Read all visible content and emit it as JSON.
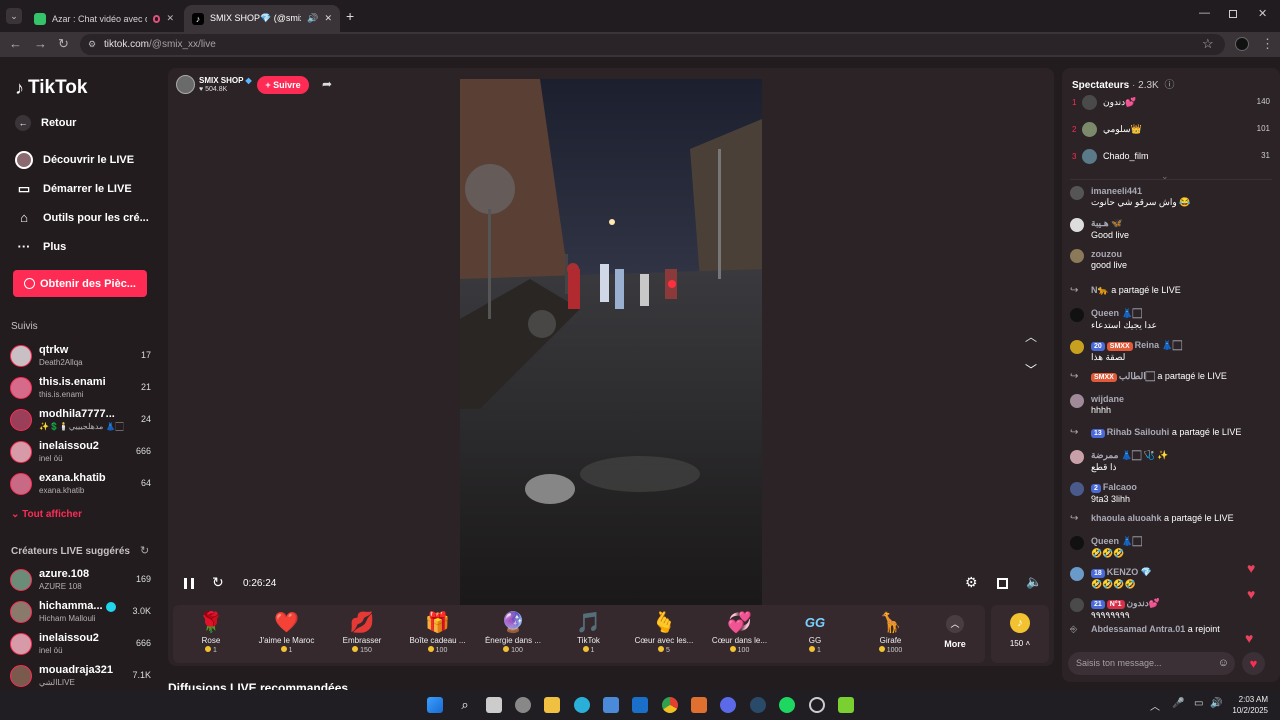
{
  "browser": {
    "tabs": [
      {
        "label": "Azar : Chat vidéo avec de n",
        "active": false
      },
      {
        "label": "SMIX SHOP💎 (@smix_xx) e",
        "active": true
      }
    ],
    "url": "tiktok.com/@smix_xx/live",
    "url_host": "tiktok.com",
    "url_path": "/@smix_xx/live"
  },
  "sidebar": {
    "logo": "TikTok",
    "back": "Retour",
    "nav": [
      {
        "label": "Découvrir le LIVE",
        "icon": "discover-live-icon"
      },
      {
        "label": "Démarrer le LIVE",
        "icon": "camera-icon"
      },
      {
        "label": "Outils pour les cré...",
        "icon": "home-tools-icon"
      },
      {
        "label": "Plus",
        "icon": "more-dots-icon"
      }
    ],
    "coins_button": "Obtenir des Pièc...",
    "following_title": "Suivis",
    "following": [
      {
        "name": "qtrkw",
        "sub": "Death2Allqa",
        "count": "17",
        "color": "#c8c0c4"
      },
      {
        "name": "this.is.enami",
        "sub": "this.is.enami",
        "count": "21",
        "color": "#d66a8a"
      },
      {
        "name": "modhila7777...",
        "sub": "✨💲🕯️مدهلجيييي 👗🏻🕯️",
        "count": "24",
        "color": "#9a3e5a"
      },
      {
        "name": "inelaissou2",
        "sub": "inel öü",
        "count": "666",
        "color": "#d69aa8"
      },
      {
        "name": "exana.khatib",
        "sub": "exana.khatib",
        "count": "64",
        "color": "#c86a86"
      }
    ],
    "show_all": "Tout afficher",
    "suggested_title": "Créateurs LIVE suggérés",
    "suggested": [
      {
        "name": "azure.108",
        "sub": "AZURE 108",
        "count": "169",
        "color": "#6c8c7a"
      },
      {
        "name": "hichamma...",
        "sub": "Hicham Mallouli",
        "count": "3.0K",
        "color": "#8a7a6c",
        "verified": true
      },
      {
        "name": "inelaissou2",
        "sub": "inel öü",
        "count": "666",
        "color": "#d69aa8"
      },
      {
        "name": "mouadraja321",
        "sub": "الشيLIVE",
        "count": "7.1K",
        "color": "#7a5a4c"
      }
    ]
  },
  "host": {
    "name": "SMIX SHOP",
    "likes": "504.8K",
    "follow_button": "+ Suivre"
  },
  "player": {
    "time": "0:26:24"
  },
  "gifts": [
    {
      "name": "Rose",
      "price": "1",
      "icon": "rose-icon",
      "glyph": "🌹"
    },
    {
      "name": "J'aime le Maroc",
      "price": "1",
      "icon": "heart-morocco-icon",
      "glyph": "❤️"
    },
    {
      "name": "Embrasser",
      "price": "150",
      "icon": "lips-icon",
      "glyph": "💋"
    },
    {
      "name": "Boîte cadeau ...",
      "price": "100",
      "icon": "gift-box-icon",
      "glyph": "🎁"
    },
    {
      "name": "Énergie dans ...",
      "price": "100",
      "icon": "energy-orb-icon",
      "glyph": "🔮"
    },
    {
      "name": "TikTok",
      "price": "1",
      "icon": "tiktok-gift-icon",
      "glyph": "🎵"
    },
    {
      "name": "Cœur avec les...",
      "price": "5",
      "icon": "hand-heart-icon",
      "glyph": "🫰"
    },
    {
      "name": "Cœur dans le...",
      "price": "100",
      "icon": "heart-dance-icon",
      "glyph": "💞"
    },
    {
      "name": "GG",
      "price": "1",
      "icon": "gg-icon",
      "glyph": "GG"
    },
    {
      "name": "Girafe",
      "price": "1000",
      "icon": "giraffe-icon",
      "glyph": "🦒"
    }
  ],
  "gifts_more": "More",
  "coin_balance": "150",
  "viewers": {
    "title": "Spectateurs",
    "count": "2.3K",
    "top": [
      {
        "rank": "1",
        "name": "دندون💕",
        "score": "140",
        "color": "#4a4a4a"
      },
      {
        "rank": "2",
        "name": "سلومي👑",
        "score": "101",
        "color": "#7a8a6a"
      },
      {
        "rank": "3",
        "name": "Chado_film",
        "score": "31",
        "color": "#5a7a8a"
      }
    ]
  },
  "chat": [
    {
      "name": "imaneeli441",
      "text": "واش سرقو شي حانوت 😂",
      "color": "#555"
    },
    {
      "name": "هـيبة 🦋",
      "text": "Good live",
      "color": "#ddd"
    },
    {
      "name": "zouzou",
      "text": "good live",
      "color": "#8a7a5a"
    },
    {
      "name": "N🐆",
      "text": "a partagé le LIVE",
      "share": true
    },
    {
      "name": "Queen 👗🏻",
      "text": "عدا يجيك استدعاء",
      "color": "#111"
    },
    {
      "name": "Reina 👗🏻",
      "text": "لصقة هذا",
      "badges": [
        "20",
        "SMXX"
      ],
      "color": "#c8a020"
    },
    {
      "name": "الطالب🏻",
      "text": "a partagé le LIVE",
      "badges": [
        "SMXX"
      ],
      "share": true
    },
    {
      "name": "wijdane",
      "text": "hhhh",
      "color": "#a08a9a"
    },
    {
      "name": "Rihab Sailouhi",
      "text": "a partagé le LIVE",
      "badges": [
        "13"
      ],
      "share": true
    },
    {
      "name": "ممرضة 👗🏻 🩺 ✨",
      "text": "ذا قطع",
      "color": "#c8a0a8"
    },
    {
      "name": "Falcaoo",
      "text": "9ta3 3lihh",
      "badges": [
        "2"
      ],
      "color": "#4a5a8a"
    },
    {
      "name": "khaoula aluoahk",
      "text": "a partagé le LIVE",
      "share": true
    },
    {
      "name": "Queen 👗🏻",
      "text": "🤣🤣🤣",
      "color": "#111"
    },
    {
      "name": "KENZO 💎",
      "text": "🤣🤣🤣🤣",
      "badges": [
        "18"
      ],
      "color": "#6a9ac8"
    },
    {
      "name": "دندون💕",
      "text": "٩٩٩٩٩٩٩٩",
      "badges": [
        "21",
        "N°1"
      ],
      "color": "#4a4a4a"
    },
    {
      "name": "Abdessamad Antra.01",
      "text": "a rejoint",
      "join": true
    }
  ],
  "chat_input_placeholder": "Saisis ton message...",
  "recommended_title": "Diffusions LIVE recommandées",
  "taskbar": {
    "time": "2:03 AM",
    "date": "10/2/2025"
  },
  "colors": {
    "accent": "#fe2c55",
    "page_bg": "#221c1e",
    "panel_bg": "#2b2326"
  }
}
